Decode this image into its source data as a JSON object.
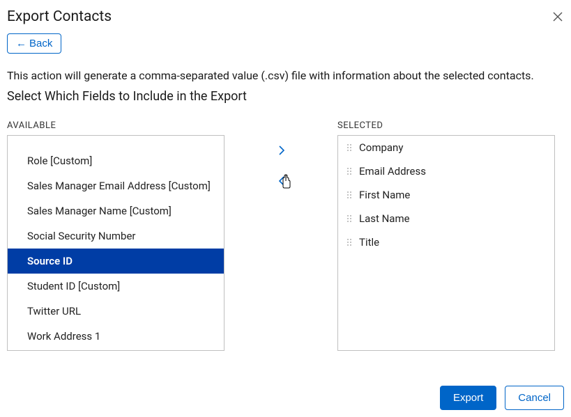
{
  "dialog": {
    "title": "Export Contacts",
    "back_label": "Back",
    "description": "This action will generate a comma-separated value (.csv) file with information about the selected contacts.",
    "subheading": "Select Which Fields to Include in the Export",
    "available_label": "AVAILABLE",
    "selected_label": "SELECTED",
    "export_label": "Export",
    "cancel_label": "Cancel"
  },
  "available": {
    "items": [
      "Role [Custom]",
      "Sales Manager Email Address [Custom]",
      "Sales Manager Name [Custom]",
      "Social Security Number",
      "Source ID",
      "Student ID [Custom]",
      "Twitter URL",
      "Work Address 1"
    ],
    "selected_index": 4
  },
  "selected": {
    "items": [
      "Company",
      "Email Address",
      "First Name",
      "Last Name",
      "Title"
    ]
  }
}
